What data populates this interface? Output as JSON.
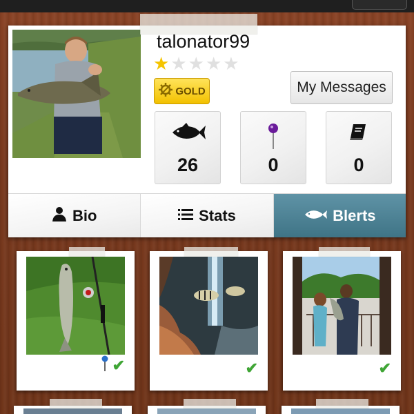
{
  "profile": {
    "username": "talonator99",
    "rating": 1,
    "max_rating": 5,
    "badge_label": "GOLD",
    "messages_button": "My Messages"
  },
  "stats": {
    "fish_count": "26",
    "pins_count": "0",
    "logbook_count": "0"
  },
  "tabs": [
    {
      "label": "Bio",
      "icon": "person-icon"
    },
    {
      "label": "Stats",
      "icon": "list-icon"
    },
    {
      "label": "Blerts",
      "icon": "fish-icon"
    }
  ],
  "active_tab": "Blerts",
  "photos": [
    {
      "subject": "bass on grass with fishing rod",
      "has_pin": true,
      "verified": true
    },
    {
      "subject": "aquarium with striped fish",
      "has_pin": false,
      "verified": true
    },
    {
      "subject": "kids holding fish on porch",
      "has_pin": false,
      "verified": true
    }
  ],
  "colors": {
    "active_tab": "#4a8092",
    "gold": "#f5c400",
    "check": "#3fa535",
    "pin": "#6a1b9a"
  }
}
